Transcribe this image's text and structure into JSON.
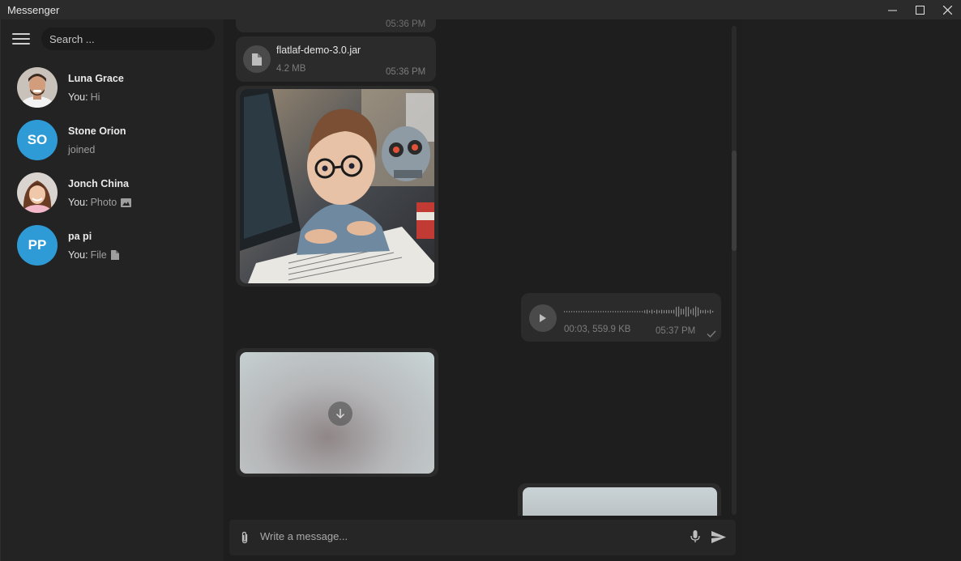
{
  "window": {
    "title": "Messenger",
    "controls": [
      "minimize-icon",
      "maximize-icon",
      "close-icon"
    ]
  },
  "sidebar": {
    "search_placeholder": "Search ...",
    "chats": [
      {
        "name": "Luna Grace",
        "prefix": "You:",
        "last": "Hi",
        "avatar": "photo",
        "icon": null
      },
      {
        "name": "Stone Orion",
        "prefix": "",
        "last": "joined",
        "avatar": "SO",
        "icon": null
      },
      {
        "name": "Jonch China",
        "prefix": "You:",
        "last": "Photo",
        "avatar": "photo",
        "icon": "image-icon"
      },
      {
        "name": "pa pi",
        "prefix": "You:",
        "last": "File",
        "avatar": "PP",
        "icon": "file-icon"
      }
    ]
  },
  "messages": {
    "top_partial_time": "05:36 PM",
    "file": {
      "name": "flatlaf-demo-3.0.jar",
      "size": "4.2 MB",
      "time": "05:36 PM"
    },
    "voice": {
      "duration_size": "00:03, 559.9 KB",
      "time": "05:37 PM"
    }
  },
  "composer": {
    "placeholder": "Write a message..."
  },
  "colors": {
    "accent_avatar": "#2e9bd6",
    "bubble": "#2b2b2b",
    "background": "#1e1e1e"
  }
}
